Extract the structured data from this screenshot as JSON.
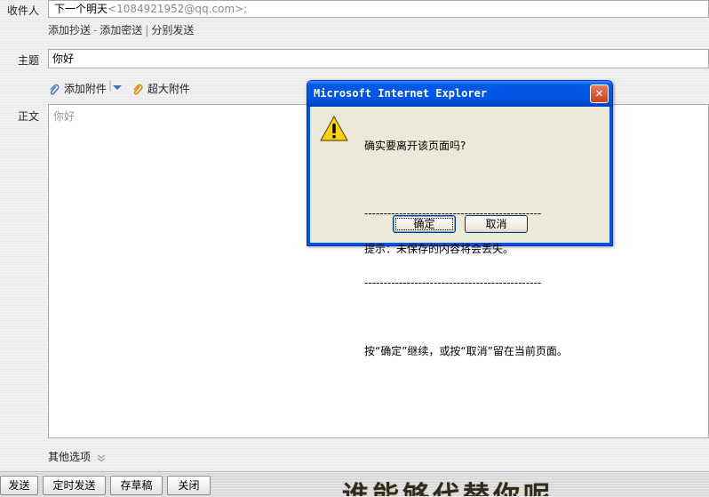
{
  "compose": {
    "recipient_label": "收件人",
    "recipient_name": "下一个明天",
    "recipient_address": "<1084921952@qq.com>;",
    "add_cc": "添加抄送",
    "add_bcc": "添加密送",
    "separate_send": "分别发送",
    "subject_label": "主题",
    "subject_value": "你好",
    "add_attachment": "添加附件",
    "large_attachment": "超大附件",
    "body_label": "正文",
    "body_value": "你好",
    "other_options": "其他选项"
  },
  "toolbar": {
    "send": "发送",
    "scheduled_send": "定时发送",
    "save_draft": "存草稿",
    "close": "关闭"
  },
  "watermark_text": "谁能够代替你呢",
  "dialog": {
    "title": "Microsoft Internet Explorer",
    "line1": "确实要离开该页面吗?",
    "divider1": "----------------------------------------------",
    "line2": "提示：未保存的内容将会丢失。",
    "divider2": "----------------------------------------------",
    "line3": "按“确定”继续，或按“取消”留在当前页面。",
    "ok": "确定",
    "cancel": "取消",
    "close_glyph": "✕",
    "icon": "warning-icon"
  },
  "colors": {
    "titlebar": "#0054e3",
    "dialog_bg": "#ece9d8",
    "close_button": "#c8421c"
  }
}
